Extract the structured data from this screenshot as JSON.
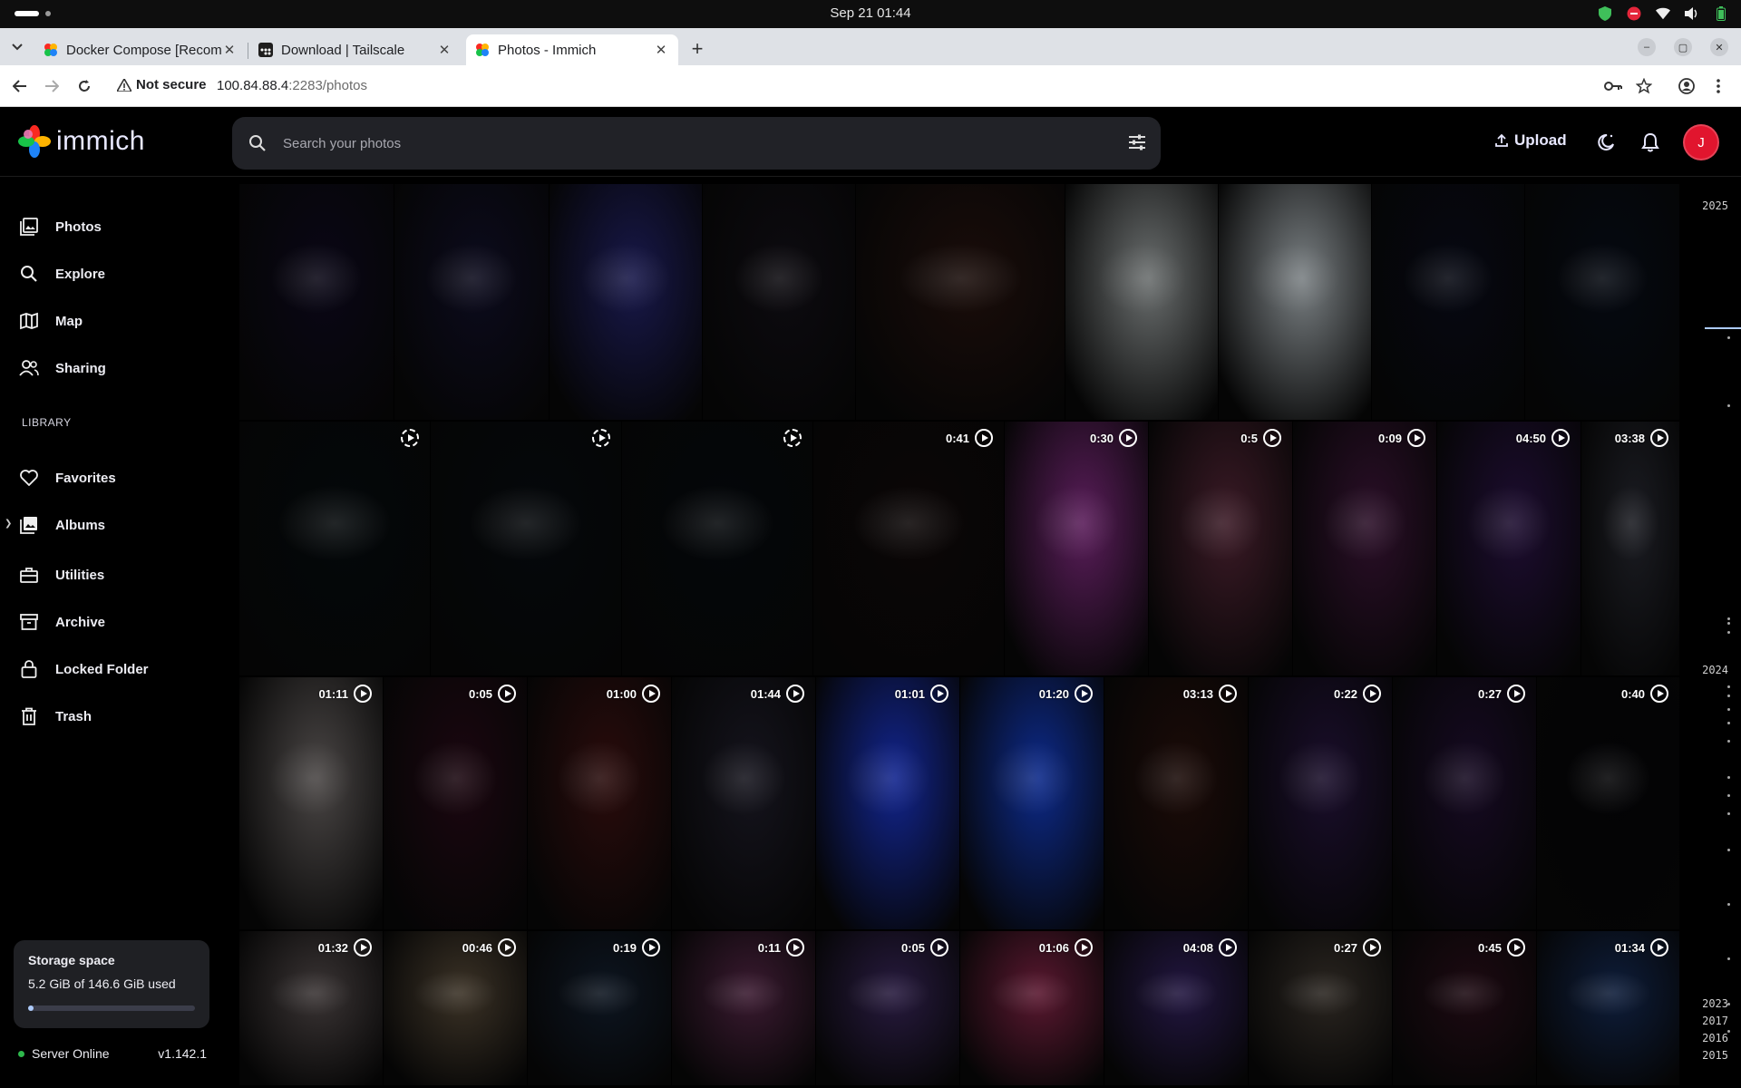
{
  "os": {
    "clock": "Sep 21  01:44"
  },
  "browser": {
    "tabs": [
      {
        "title": "Docker Compose [Recom",
        "favicon": "immich-icon"
      },
      {
        "title": "Download | Tailscale",
        "favicon": "tailscale-icon"
      },
      {
        "title": "Photos - Immich",
        "favicon": "immich-icon",
        "active": true
      }
    ],
    "security_label": "Not secure",
    "url_host": "100.84.88.4",
    "url_path": ":2283/photos"
  },
  "app": {
    "logo_text": "immich",
    "search_placeholder": "Search your photos",
    "upload_label": "Upload",
    "avatar_initial": "J",
    "accent": "#adcbfa",
    "avatar_color": "#e1152e"
  },
  "sidebar": {
    "items": [
      {
        "label": "Photos",
        "icon": "photos-icon"
      },
      {
        "label": "Explore",
        "icon": "search-icon"
      },
      {
        "label": "Map",
        "icon": "map-icon"
      },
      {
        "label": "Sharing",
        "icon": "sharing-icon"
      }
    ],
    "library_label": "LIBRARY",
    "library_items": [
      {
        "label": "Favorites",
        "icon": "heart-icon"
      },
      {
        "label": "Albums",
        "icon": "albums-icon"
      },
      {
        "label": "Utilities",
        "icon": "toolbox-icon"
      },
      {
        "label": "Archive",
        "icon": "archive-icon"
      },
      {
        "label": "Locked Folder",
        "icon": "lock-icon"
      },
      {
        "label": "Trash",
        "icon": "trash-icon"
      }
    ],
    "storage": {
      "title": "Storage space",
      "used_text": "5.2 GiB of 146.6 GiB used",
      "used_fraction": 0.035
    },
    "server_status": "Server Online",
    "version": "v1.142.1"
  },
  "timeline": {
    "years": [
      "2025",
      "2024",
      "2023",
      "2017",
      "2016",
      "2015"
    ]
  },
  "rows": [
    {
      "tiles": [
        {
          "duration": "",
          "bg": "#0a0716"
        },
        {
          "duration": "",
          "bg": "#0c0b1d"
        },
        {
          "duration": "",
          "bg": "#18184a"
        },
        {
          "duration": "",
          "bg": "#0d0b10"
        },
        {
          "duration": "",
          "bg": "#1a0d0a"
        },
        {
          "duration": "",
          "bg": "#6b6f6f"
        },
        {
          "duration": "",
          "bg": "#7b8184"
        },
        {
          "duration": "",
          "bg": "#060812"
        },
        {
          "duration": "",
          "bg": "#050911"
        }
      ]
    },
    {
      "tiles": [
        {
          "duration": "",
          "bg": "#04080a"
        },
        {
          "duration": "",
          "bg": "#05080b"
        },
        {
          "duration": "",
          "bg": "#04070a"
        },
        {
          "duration": "0:41",
          "bg": "#0b0606"
        },
        {
          "duration": "0:30",
          "bg": "#5a1d5a"
        },
        {
          "duration": "0:5",
          "bg": "#3b1a26"
        },
        {
          "duration": "0:09",
          "bg": "#2b0f28"
        },
        {
          "duration": "04:50",
          "bg": "#1d0d30"
        },
        {
          "duration": "03:38",
          "bg": "#1b1c22"
        }
      ]
    },
    {
      "tiles": [
        {
          "duration": "01:11",
          "bg": "#4a4645"
        },
        {
          "duration": "0:05",
          "bg": "#1b0710"
        },
        {
          "duration": "01:00",
          "bg": "#2a0c0c"
        },
        {
          "duration": "01:44",
          "bg": "#15141d"
        },
        {
          "duration": "01:01",
          "bg": "#12258f"
        },
        {
          "duration": "01:20",
          "bg": "#0d2a8a"
        },
        {
          "duration": "03:13",
          "bg": "#1b0b08"
        },
        {
          "duration": "0:22",
          "bg": "#1a0e2b"
        },
        {
          "duration": "0:27",
          "bg": "#160a22"
        },
        {
          "duration": "0:40",
          "bg": "#030305"
        }
      ]
    },
    {
      "tiles": [
        {
          "duration": "01:32",
          "bg": "#3a3434"
        },
        {
          "duration": "00:46",
          "bg": "#3b3226"
        },
        {
          "duration": "0:19",
          "bg": "#0d1520"
        },
        {
          "duration": "0:11",
          "bg": "#3a1a30"
        },
        {
          "duration": "0:05",
          "bg": "#271a3e"
        },
        {
          "duration": "01:06",
          "bg": "#5a1830"
        },
        {
          "duration": "04:08",
          "bg": "#221640"
        },
        {
          "duration": "0:27",
          "bg": "#2a2520"
        },
        {
          "duration": "0:45",
          "bg": "#1d0a12"
        },
        {
          "duration": "01:34",
          "bg": "#0e1d3a"
        }
      ]
    }
  ]
}
